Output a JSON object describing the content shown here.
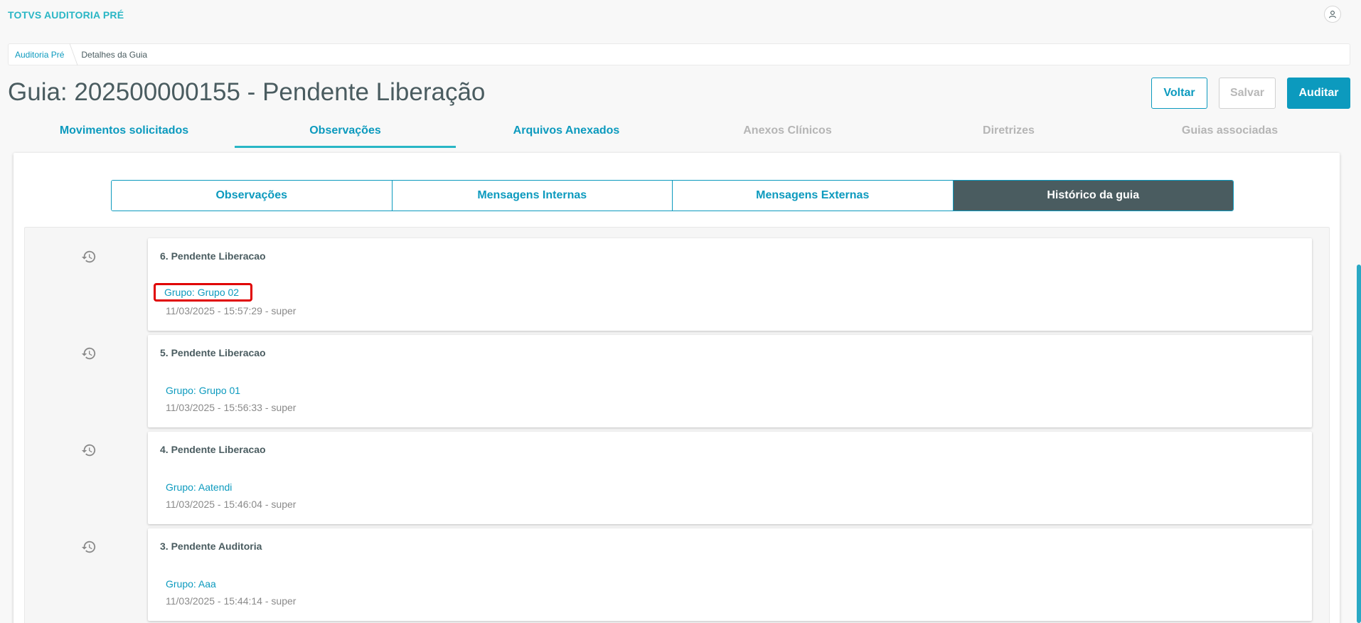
{
  "app": {
    "title": "TOTVS AUDITORIA PRÉ"
  },
  "breadcrumb": {
    "items": [
      "Auditoria Pré",
      "Detalhes da Guia"
    ]
  },
  "page": {
    "title": "Guia: 202500000155 - Pendente Liberação"
  },
  "actions": {
    "voltar": "Voltar",
    "salvar": "Salvar",
    "auditar": "Auditar"
  },
  "tabs": [
    {
      "label": "Movimentos solicitados",
      "state": "enabled"
    },
    {
      "label": "Observações",
      "state": "active"
    },
    {
      "label": "Arquivos Anexados",
      "state": "enabled"
    },
    {
      "label": "Anexos Clínicos",
      "state": "disabled"
    },
    {
      "label": "Diretrizes",
      "state": "disabled"
    },
    {
      "label": "Guias associadas",
      "state": "disabled"
    }
  ],
  "segments": [
    {
      "label": "Observações",
      "active": false
    },
    {
      "label": "Mensagens Internas",
      "active": false
    },
    {
      "label": "Mensagens Externas",
      "active": false
    },
    {
      "label": "Histórico da guia",
      "active": true
    }
  ],
  "history": [
    {
      "title": "6. Pendente Liberacao",
      "group": "Grupo: Grupo 02",
      "meta": "11/03/2025 - 15:57:29 - super",
      "highlighted": true
    },
    {
      "title": "5. Pendente Liberacao",
      "group": "Grupo: Grupo 01",
      "meta": "11/03/2025 - 15:56:33 - super",
      "highlighted": false
    },
    {
      "title": "4. Pendente Liberacao",
      "group": "Grupo: Aatendi",
      "meta": "11/03/2025 - 15:46:04 - super",
      "highlighted": false
    },
    {
      "title": "3. Pendente Auditoria",
      "group": "Grupo: Aaa",
      "meta": "11/03/2025 - 15:44:14 - super",
      "highlighted": false
    }
  ],
  "colors": {
    "primary": "#0c9abe",
    "accent": "#29b6c5",
    "dark": "#4a5c60",
    "highlight": "#e00000"
  },
  "icons": {
    "user": "user-icon",
    "history": "history-icon"
  }
}
